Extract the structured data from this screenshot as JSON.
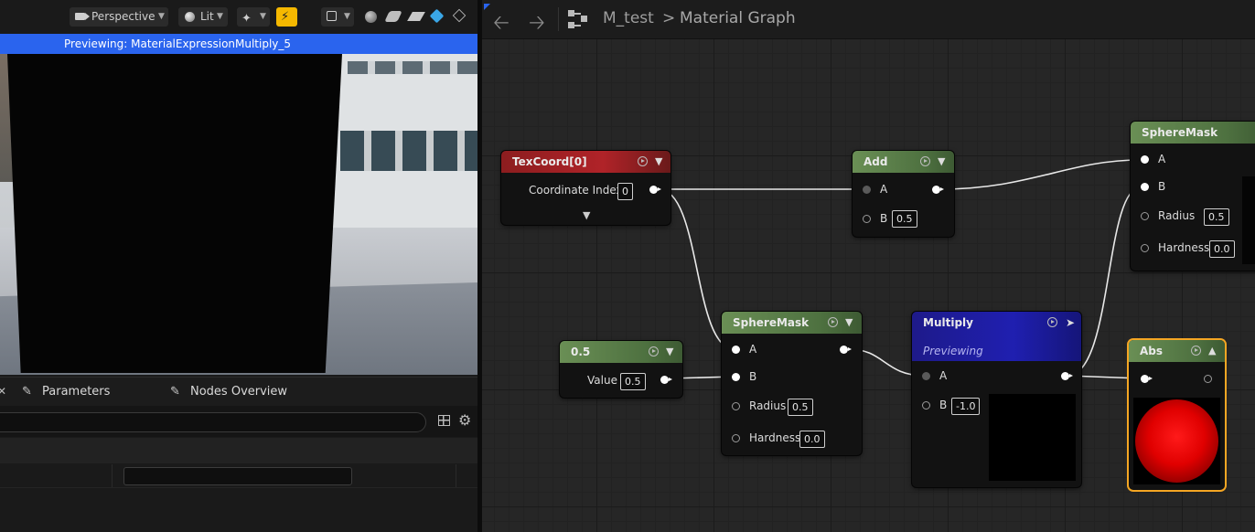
{
  "toolbar": {
    "perspective_label": "Perspective",
    "lit_label": "Lit"
  },
  "preview_banner": "Previewing: MaterialExpressionMultiply_5",
  "details_tabs": {
    "parameters": "Parameters",
    "nodes_overview": "Nodes Overview"
  },
  "graph": {
    "breadcrumb_asset": "M_test",
    "breadcrumb_separator": ">",
    "breadcrumb_graph": "Material Graph"
  },
  "nodes": {
    "texcoord": {
      "title": "TexCoord[0]",
      "coordinate_index_label": "Coordinate Index",
      "coordinate_index_value": "0"
    },
    "add": {
      "title": "Add",
      "pin_a": "A",
      "pin_b": "B",
      "b_value": "0.5"
    },
    "spheremask_top": {
      "title": "SphereMask",
      "pin_a": "A",
      "pin_b": "B",
      "radius_label": "Radius",
      "radius_value": "0.5",
      "hardness_label": "Hardness",
      "hardness_value": "0.0"
    },
    "constant": {
      "title": "0.5",
      "value_label": "Value",
      "value": "0.5"
    },
    "spheremask_bottom": {
      "title": "SphereMask",
      "pin_a": "A",
      "pin_b": "B",
      "radius_label": "Radius",
      "radius_value": "0.5",
      "hardness_label": "Hardness",
      "hardness_value": "0.0"
    },
    "multiply": {
      "title": "Multiply",
      "subtitle": "Previewing",
      "pin_a": "A",
      "pin_b": "B",
      "b_value": "-1.0"
    },
    "abs": {
      "title": "Abs"
    }
  },
  "colors": {
    "preview_banner": "#2a64ee",
    "selection_outline": "#f5a623",
    "texcoord_header": "#b02328",
    "scalar_header": "#4e7140",
    "multiply_header": "#1f1fb0",
    "realtime_toggle": "#f5b800"
  },
  "icons": [
    "camera-icon",
    "lit-sphere-icon",
    "show-flags-icon",
    "realtime-icon",
    "preview-mesh-icon",
    "sphere-icon",
    "cylinder-icon",
    "plane-icon",
    "cube-icon",
    "custom-mesh-icon",
    "back-arrow-icon",
    "forward-arrow-icon",
    "graph-icon",
    "table-icon",
    "gear-icon",
    "pencil-icon"
  ]
}
